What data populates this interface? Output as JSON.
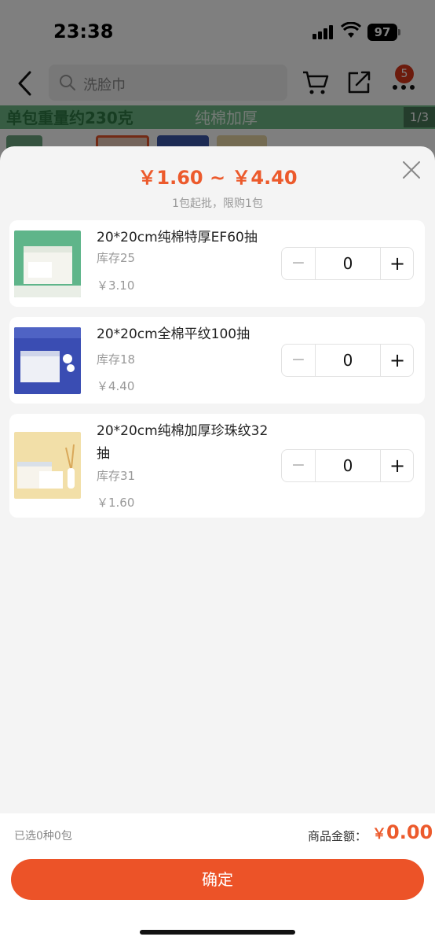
{
  "status_bar": {
    "time": "23:38",
    "battery": "97"
  },
  "nav": {
    "search_text": "洗脸巾",
    "cart_badge": "5"
  },
  "banner": {
    "left_text": "单包重量约230克",
    "mid_text": "纯棉加厚",
    "pager": "1/3"
  },
  "sheet": {
    "price_range": "￥1.60 ~ ￥4.40",
    "min_order": "1包起批，限购1包",
    "skus": [
      {
        "name": "20*20cm纯棉特厚EF60抽",
        "stock": "库存25",
        "price": "￥3.10",
        "quantity": "0",
        "minus": "−",
        "plus": "+",
        "thumb_color": "#5fb58a"
      },
      {
        "name": "20*20cm全棉平纹100抽",
        "stock": "库存18",
        "price": "￥4.40",
        "quantity": "0",
        "minus": "−",
        "plus": "+",
        "thumb_color": "#3a4db3"
      },
      {
        "name": "20*20cm纯棉加厚珍珠纹32抽",
        "stock": "库存31",
        "price": "￥1.60",
        "quantity": "0",
        "minus": "−",
        "plus": "+",
        "thumb_color": "#f2dfa8"
      }
    ]
  },
  "footer": {
    "selected_summary": "已选0种0包",
    "total_label": "商品金额：",
    "total_currency": "￥",
    "total_amount": "0.00",
    "confirm_label": "确定"
  },
  "colors": {
    "accent": "#ec5328",
    "price": "#ec5a2c",
    "badge": "#d9361b"
  }
}
